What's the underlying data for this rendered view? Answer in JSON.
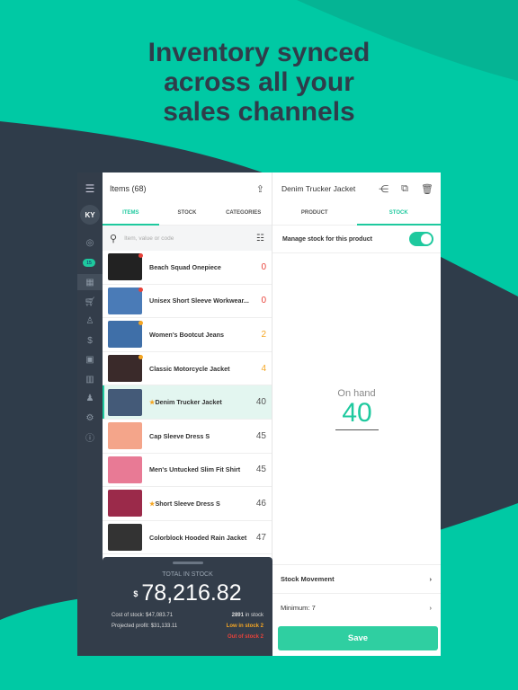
{
  "headline": [
    "Inventory synced",
    "across all your",
    "sales channels"
  ],
  "colors": {
    "accent": "#1ec99e",
    "bg_teal": "#00c9a4",
    "navy": "#333d4a",
    "low": "#f5a623",
    "out": "#e8423a"
  },
  "sidebar": {
    "avatar": "KY",
    "badge": "15",
    "icons": [
      "menu-icon",
      "check-circle-icon",
      "grid-icon",
      "cart-icon",
      "person-icon",
      "dollar-icon",
      "wallet-icon",
      "bar-chart-icon",
      "users-icon",
      "gear-icon",
      "help-icon"
    ]
  },
  "list": {
    "title": "Items (68)",
    "tabs": [
      "ITEMS",
      "STOCK",
      "CATEGORIES"
    ],
    "search_placeholder": "Item, value or code",
    "items": [
      {
        "name": "Beach Squad Onepiece",
        "qty": "0",
        "qcolor": "#e8423a",
        "thumb": "#222",
        "dot": "#e8423a",
        "star": false
      },
      {
        "name": "Unisex Short Sleeve Workwear...",
        "qty": "0",
        "qcolor": "#e8423a",
        "thumb": "#4a7bb7",
        "dot": "#e8423a",
        "star": false
      },
      {
        "name": "Women's Bootcut Jeans",
        "qty": "2",
        "qcolor": "#f5a623",
        "thumb": "#3f6fa8",
        "dot": "#f5a623",
        "star": false
      },
      {
        "name": "Classic Motorcycle Jacket",
        "qty": "4",
        "qcolor": "#f5a623",
        "thumb": "#3a2a2a",
        "dot": "#f5a623",
        "star": false
      },
      {
        "name": "Denim Trucker Jacket",
        "qty": "40",
        "qcolor": "#555",
        "thumb": "#445a78",
        "dot": "",
        "star": true
      },
      {
        "name": "Cap Sleeve Dress S",
        "qty": "45",
        "qcolor": "#555",
        "thumb": "#f4a58a",
        "dot": "",
        "star": false
      },
      {
        "name": "Men's Untucked Slim Fit Shirt",
        "qty": "45",
        "qcolor": "#555",
        "thumb": "#e87a95",
        "dot": "",
        "star": false
      },
      {
        "name": "Short Sleeve Dress S",
        "qty": "46",
        "qcolor": "#555",
        "thumb": "#9b2a4a",
        "dot": "",
        "star": true
      },
      {
        "name": "Colorblock Hooded Rain Jacket",
        "qty": "47",
        "qcolor": "#555",
        "thumb": "#333",
        "dot": "",
        "star": false
      }
    ]
  },
  "total": {
    "label": "TOTAL IN STOCK",
    "currency": "$",
    "amount": "78,216.82",
    "cost": "Cost of stock: $47,083.71",
    "profit": "Projected profit: $31,133.11",
    "in_stock_count": "2891",
    "in_stock_label": " in stock",
    "low": "Low in stock 2",
    "out": "Out of stock 2"
  },
  "detail": {
    "title": "Denim Trucker Jacket",
    "tabs": [
      "PRODUCT",
      "STOCK"
    ],
    "manage_label": "Manage stock for this product",
    "manage_on": true,
    "on_hand_label": "On hand",
    "on_hand": "40",
    "stock_movement": "Stock Movement",
    "minimum": "Minimum: 7",
    "save": "Save"
  }
}
